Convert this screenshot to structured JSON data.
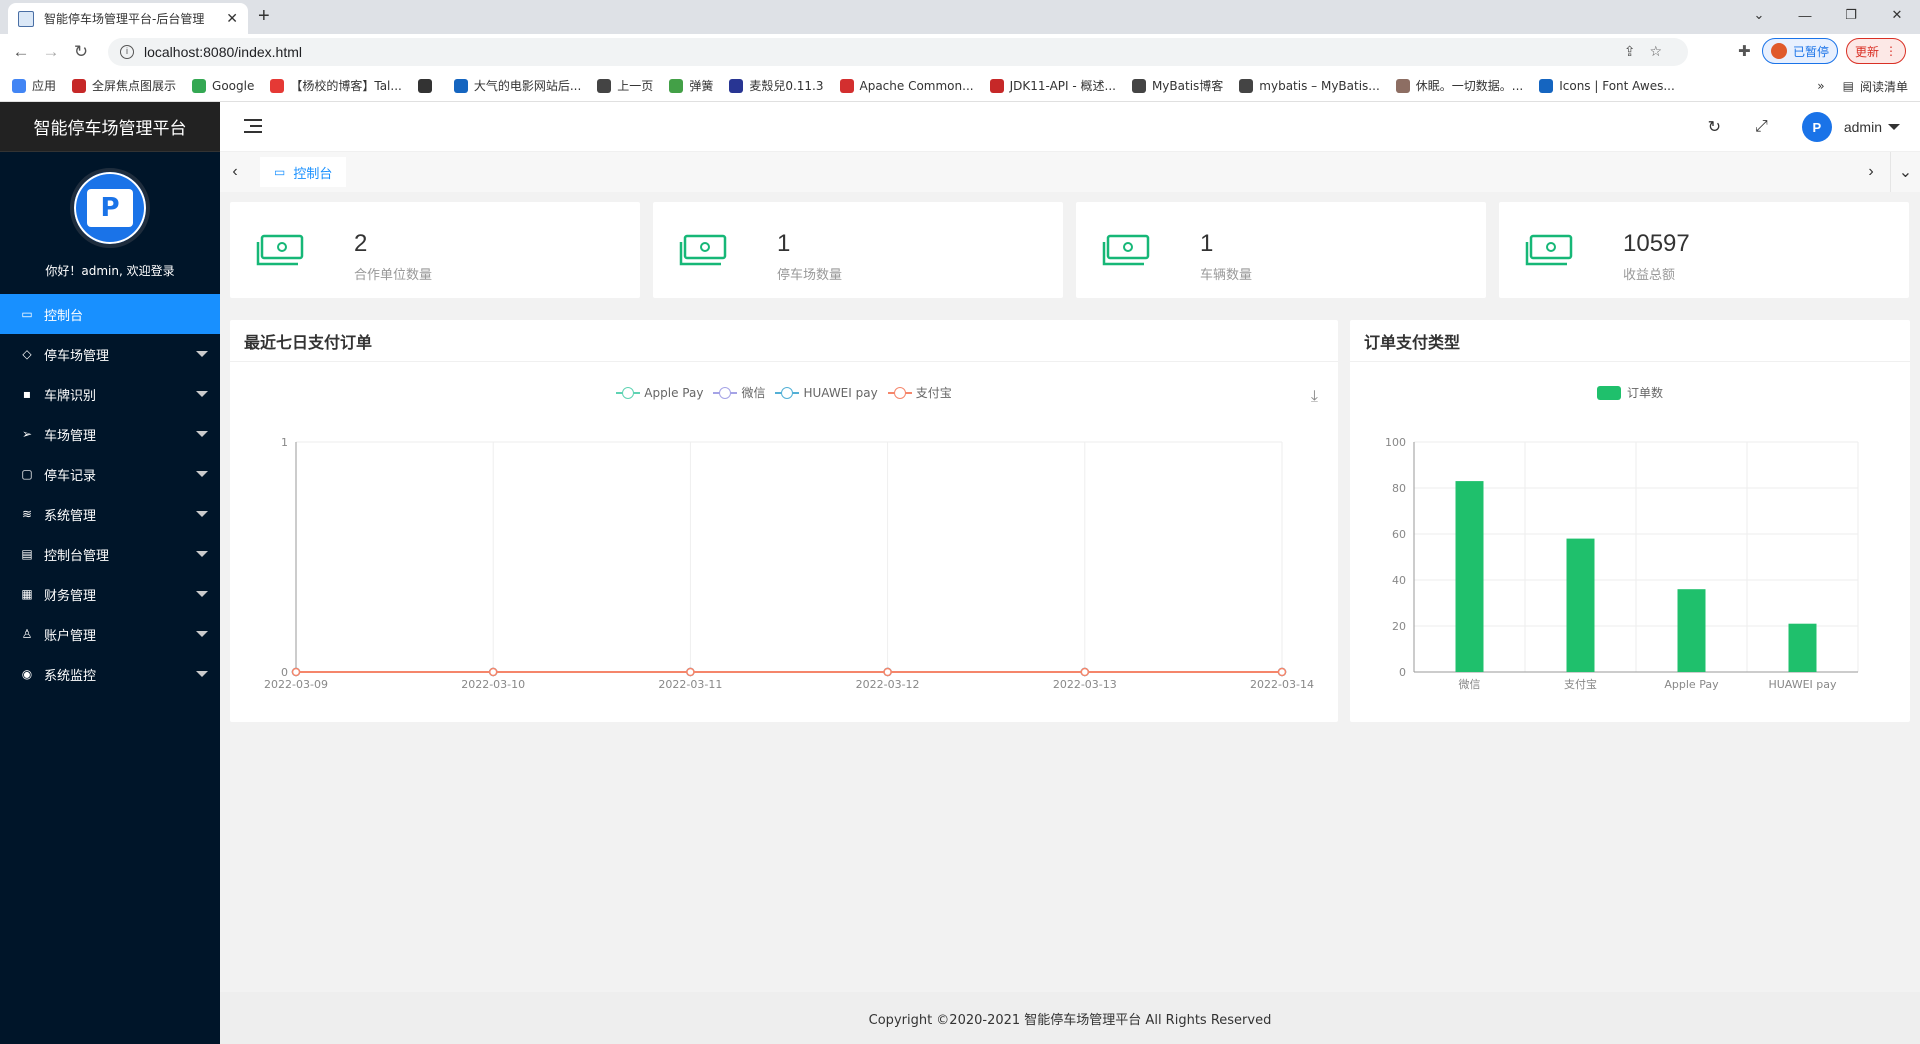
{
  "browser": {
    "tab_title": "智能停车场管理平台-后台管理",
    "url": "localhost:8080/index.html",
    "ext_paused": "已暂停",
    "ext_update": "更新",
    "bookmarks": [
      {
        "label": "应用",
        "color": "#4285f4"
      },
      {
        "label": "全屏焦点图展示",
        "color": "#c62828"
      },
      {
        "label": "Google",
        "color": "#34a853"
      },
      {
        "label": "【杨校的博客】Tal...",
        "color": "#e53935"
      },
      {
        "label": "",
        "color": "#333333"
      },
      {
        "label": "大气的电影网站后...",
        "color": "#1565c0"
      },
      {
        "label": "上一页",
        "color": "#444444"
      },
      {
        "label": "弹簧",
        "color": "#43a047"
      },
      {
        "label": "麦殼兒0.11.3",
        "color": "#283593"
      },
      {
        "label": "Apache Common...",
        "color": "#d32f2f"
      },
      {
        "label": "JDK11-API - 概述...",
        "color": "#c62828"
      },
      {
        "label": "MyBatis博客",
        "color": "#444444"
      },
      {
        "label": "mybatis – MyBatis...",
        "color": "#444444"
      },
      {
        "label": "休眠。一切数据。...",
        "color": "#8d6e63"
      },
      {
        "label": "Icons | Font Awes...",
        "color": "#1565c0"
      }
    ],
    "reading_list": "阅读清单"
  },
  "sidebar": {
    "brand": "智能停车场管理平台",
    "welcome": "你好！admin, 欢迎登录",
    "items": [
      {
        "label": "控制台",
        "icon": "monitor-icon",
        "glyph": "▭",
        "active": true,
        "caret": false
      },
      {
        "label": "停车场管理",
        "icon": "diamond-icon",
        "glyph": "◇",
        "active": false,
        "caret": true
      },
      {
        "label": "车牌识别",
        "icon": "briefcase-icon",
        "glyph": "▪",
        "active": false,
        "caret": true
      },
      {
        "label": "车场管理",
        "icon": "send-icon",
        "glyph": "➢",
        "active": false,
        "caret": true
      },
      {
        "label": "停车记录",
        "icon": "note-icon",
        "glyph": "▢",
        "active": false,
        "caret": true
      },
      {
        "label": "系统管理",
        "icon": "layers-icon",
        "glyph": "≋",
        "active": false,
        "caret": true
      },
      {
        "label": "控制台管理",
        "icon": "clipboard-icon",
        "glyph": "▤",
        "active": false,
        "caret": true
      },
      {
        "label": "财务管理",
        "icon": "grid-icon",
        "glyph": "▦",
        "active": false,
        "caret": true
      },
      {
        "label": "账户管理",
        "icon": "user-icon",
        "glyph": "♙",
        "active": false,
        "caret": true
      },
      {
        "label": "系统监控",
        "icon": "camera-icon",
        "glyph": "◉",
        "active": false,
        "caret": true
      }
    ]
  },
  "topbar": {
    "username": "admin"
  },
  "tabs": {
    "active_label": "控制台"
  },
  "stats": [
    {
      "value": "2",
      "label": "合作单位数量"
    },
    {
      "value": "1",
      "label": "停车场数量"
    },
    {
      "value": "1",
      "label": "车辆数量"
    },
    {
      "value": "10597",
      "label": "收益总额"
    }
  ],
  "colors": {
    "accent": "#1890ff",
    "stat_icon": "#16b777",
    "bar": "#1fc06c"
  },
  "chart_data": [
    {
      "type": "line",
      "title": "最近七日支付订单",
      "x": [
        "2022-03-09",
        "2022-03-10",
        "2022-03-11",
        "2022-03-12",
        "2022-03-13",
        "2022-03-14"
      ],
      "series": [
        {
          "name": "Apple Pay",
          "color": "#5fd3b3",
          "values": [
            0,
            0,
            0,
            0,
            0,
            0
          ]
        },
        {
          "name": "微信",
          "color": "#a5a3e6",
          "values": [
            0,
            0,
            0,
            0,
            0,
            0
          ]
        },
        {
          "name": "HUAWEI pay",
          "color": "#53b0d6",
          "values": [
            0,
            0,
            0,
            0,
            0,
            0
          ]
        },
        {
          "name": "支付宝",
          "color": "#f5866b",
          "values": [
            0,
            0,
            0,
            0,
            0,
            0
          ]
        }
      ],
      "ylim": [
        0,
        1
      ],
      "yticks": [
        0,
        1
      ],
      "grid": true,
      "legend": "top-center"
    },
    {
      "type": "bar",
      "title": "订单支付类型",
      "categories": [
        "微信",
        "支付宝",
        "Apple Pay",
        "HUAWEI pay"
      ],
      "series": [
        {
          "name": "订单数",
          "color": "#1fc06c",
          "values": [
            83,
            58,
            36,
            21
          ]
        }
      ],
      "ylim": [
        0,
        100
      ],
      "yticks": [
        0,
        20,
        40,
        60,
        80,
        100
      ],
      "grid": true,
      "legend": "top-center"
    }
  ],
  "footer": "Copyright ©2020-2021 智能停车场管理平台 All Rights Reserved"
}
